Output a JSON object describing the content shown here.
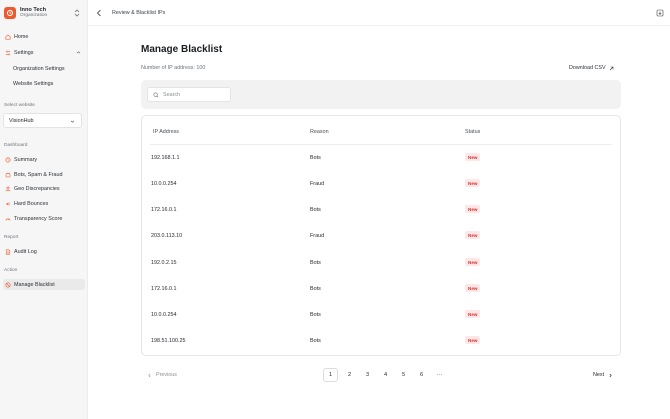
{
  "org": {
    "name": "Inno Tech",
    "subtitle": "Organization"
  },
  "nav": {
    "home": "Home",
    "settings": "Settings",
    "org_settings": "Organization Settings",
    "website_settings": "Website Settings"
  },
  "website": {
    "label": "Select website",
    "selected": "VisionHub"
  },
  "dashboard": {
    "label": "Dashboard",
    "items": [
      "Summary",
      "Bots, Spam & Fraud",
      "Geo Discrepancies",
      "Hard Bounces",
      "Transparency Score"
    ]
  },
  "report": {
    "label": "Report",
    "items": [
      "Audit Log"
    ]
  },
  "action": {
    "label": "Action",
    "items": [
      "Manage Blacklist"
    ]
  },
  "topbar": {
    "title": "Review & Blacklist IPs"
  },
  "main": {
    "title": "Manage Blacklist",
    "ip_count": "Number of IP address: 100",
    "download": "Download CSV",
    "search_placeholder": "Search"
  },
  "table": {
    "columns": [
      "IP Address",
      "Reason",
      "Status"
    ],
    "rows": [
      {
        "ip": "192.168.1.1",
        "reason": "Bots",
        "status": "New"
      },
      {
        "ip": "10.0.0.254",
        "reason": "Fraud",
        "status": "New"
      },
      {
        "ip": "172.16.0.1",
        "reason": "Bots",
        "status": "New"
      },
      {
        "ip": "203.0.113.10",
        "reason": "Fraud",
        "status": "New"
      },
      {
        "ip": "192.0.2.15",
        "reason": "Bots",
        "status": "New"
      },
      {
        "ip": "172.16.0.1",
        "reason": "Bots",
        "status": "New"
      },
      {
        "ip": "10.0.0.254",
        "reason": "Bots",
        "status": "New"
      },
      {
        "ip": "198.51.100.25",
        "reason": "Bots",
        "status": "New"
      }
    ]
  },
  "pagination": {
    "previous": "Previous",
    "next": "Next",
    "pages": [
      "1",
      "2",
      "3",
      "4",
      "5",
      "6",
      "···"
    ],
    "current": "1"
  },
  "colors": {
    "brand": "#ee5a30",
    "badge_bg": "#fde7e7",
    "badge_text": "#d93333"
  }
}
